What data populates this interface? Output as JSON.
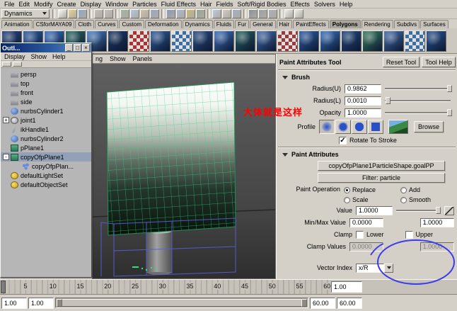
{
  "colors": {
    "ui_bg": "#d4d0c8",
    "titlebar_blue": "#0a246a",
    "annotation_red": "#ff0000",
    "wireframe_blue": "#5a5fd8",
    "grid_green": "#35d584"
  },
  "menubar": {
    "items": [
      "File",
      "Edit",
      "Modify",
      "Create",
      "Display",
      "Window",
      "Particles",
      "Fluid Effects",
      "Hair",
      "Fields",
      "Soft/Rigid Bodies",
      "Effects",
      "Solvers",
      "Help"
    ]
  },
  "statusline": {
    "menuset": "Dynamics",
    "icons": [
      {
        "name": "new-scene",
        "color": "#f7f7f2"
      },
      {
        "name": "open-scene",
        "color": "#e6d18e"
      },
      {
        "name": "save-scene",
        "color": "#8ea8cc"
      },
      {
        "divider": true
      },
      {
        "name": "undo",
        "color": "#c4c0b8"
      },
      {
        "name": "redo",
        "color": "#c4c0b8"
      },
      {
        "divider": true
      },
      {
        "name": "select-hierarchy",
        "color": "#9fb6a2"
      },
      {
        "name": "select-object",
        "color": "#b4c4de"
      },
      {
        "name": "select-component",
        "color": "#ccc2a8"
      },
      {
        "name": "snap-grid",
        "color": "#9aa8c4"
      },
      {
        "divider": true
      },
      {
        "name": "snap-curve",
        "color": "#8898b8"
      },
      {
        "name": "snap-point",
        "color": "#aab8d0"
      },
      {
        "name": "snap-view",
        "color": "#c8b878"
      },
      {
        "name": "snap-surface",
        "color": "#90a890"
      },
      {
        "divider": true
      },
      {
        "name": "input-connections",
        "color": "#b8c8e0"
      },
      {
        "name": "output-connections",
        "color": "#d0ccc4"
      },
      {
        "name": "construction-history",
        "color": "#a0b0c8"
      },
      {
        "divider": true
      },
      {
        "name": "render-current-frame",
        "color": "#889098"
      },
      {
        "name": "ipr-render",
        "color": "#98a0a8"
      },
      {
        "name": "render-globals",
        "color": "#a8b0b8"
      },
      {
        "divider": true
      },
      {
        "name": "quick-select-field",
        "color": "#eceae4"
      },
      {
        "name": "quick-help",
        "color": "#eceae4"
      }
    ]
  },
  "shelf": {
    "tabs": [
      {
        "label": "Animation"
      },
      {
        "label": "CSforMAYA09"
      },
      {
        "label": "Cloth"
      },
      {
        "label": "Curves"
      },
      {
        "label": "Custom"
      },
      {
        "label": "Deformation"
      },
      {
        "label": "Dynamics"
      },
      {
        "label": "Fluids"
      },
      {
        "label": "Fur"
      },
      {
        "label": "General"
      },
      {
        "label": "Hair"
      },
      {
        "label": "PaintEffects"
      },
      {
        "label": "Polygons",
        "active": true
      },
      {
        "label": "Rendering"
      },
      {
        "label": "Subdivs"
      },
      {
        "label": "Surfaces"
      }
    ],
    "tools": [
      {
        "color": "#27477f"
      },
      {
        "color": "#2f5fa6"
      },
      {
        "color": "#3b74c4"
      },
      {
        "color": "#2a6a62"
      },
      {
        "color": "#4d84c8"
      },
      {
        "color": "#1e3a66"
      },
      {
        "color": "#b03030",
        "checker": true
      },
      {
        "color": "#33609e"
      },
      {
        "color": "#3a6ea5",
        "checker": true
      },
      {
        "color": "#2b4f86"
      },
      {
        "color": "#3f74c2"
      },
      {
        "color": "#27615f"
      },
      {
        "color": "#476fae"
      },
      {
        "color": "#9a3a3a",
        "checker": true
      },
      {
        "color": "#2f5fa6"
      },
      {
        "color": "#3b74c4"
      },
      {
        "color": "#254a7e"
      },
      {
        "color": "#3a8060"
      },
      {
        "color": "#476fae"
      },
      {
        "color": "#3a6ea5",
        "checker": true
      },
      {
        "color": "#2b5590"
      }
    ]
  },
  "outliner": {
    "title": "Outl...",
    "window_buttons": [
      {
        "glyph": "_"
      },
      {
        "glyph": "□"
      },
      {
        "glyph": "×"
      }
    ],
    "menus": [
      "Display",
      "Show",
      "Help"
    ],
    "items": [
      {
        "label": "persp",
        "icon": "camera"
      },
      {
        "label": "top",
        "icon": "camera"
      },
      {
        "label": "front",
        "icon": "camera"
      },
      {
        "label": "side",
        "icon": "camera"
      },
      {
        "label": "nurbsCylinder1",
        "icon": "nurbs"
      },
      {
        "label": "joint1",
        "icon": "joint",
        "expander": "+"
      },
      {
        "label": "ikHandle1",
        "icon": "ikhandle"
      },
      {
        "label": "nurbsCylinder2",
        "icon": "nurbs"
      },
      {
        "label": "pPlane1",
        "icon": "mesh"
      },
      {
        "label": "copyOfpPlane1",
        "icon": "mesh",
        "expander": "-",
        "selected": true
      },
      {
        "label": "copyOfpPlan...",
        "icon": "particle",
        "child": true
      },
      {
        "label": "defaultLightSet",
        "icon": "set"
      },
      {
        "label": "defaultObjectSet",
        "icon": "set"
      }
    ]
  },
  "viewport": {
    "menu_items": [
      "ng",
      "Show",
      "Panels"
    ],
    "annotation": "大体就是这样"
  },
  "tool_settings": {
    "title": "Paint Attributes Tool",
    "reset_button": "Reset Tool",
    "help_button": "Tool Help",
    "brush": {
      "header": "Brush",
      "radius_u_label": "Radius(U)",
      "radius_u": "0.9862",
      "radius_l_label": "Radius(L)",
      "radius_l": "0.0010",
      "opacity_label": "Opacity",
      "opacity": "1.0000",
      "profile_label": "Profile",
      "browse_button": "Browse",
      "rotate_label": "Rotate To Stroke",
      "rotate_check": "✓"
    },
    "paint_attributes": {
      "header": "Paint Attributes",
      "attribute_button": "copyOfpPlane1ParticleShape.goalPP",
      "filter_button": "Filter: particle",
      "operation_label": "Paint Operation",
      "operations": [
        {
          "label": "Replace",
          "selected": true
        },
        {
          "label": "Add"
        },
        {
          "label": "Scale"
        },
        {
          "label": "Smooth"
        }
      ],
      "value_label": "Value",
      "value": "1.0000",
      "minmax_label": "Min/Max Value",
      "min_value": "0.0000",
      "max_value": "1.0000",
      "clamp_label": "Clamp",
      "clamp_lower": "Lower",
      "clamp_upper": "Upper",
      "clamp_values_label": "Clamp Values",
      "clamp_min": "0.0000",
      "clamp_max": "1.0000",
      "vector_index_label": "Vector Index",
      "vector_index": "x/R"
    }
  },
  "timeline": {
    "tick_labels": [
      5,
      10,
      15,
      20,
      25,
      30,
      35,
      40,
      45,
      50,
      55,
      60
    ],
    "current_time": "1.00",
    "playback_start": "1.00",
    "anim_start": "1.00",
    "anim_end": "60.00",
    "playback_end": "60.00"
  }
}
